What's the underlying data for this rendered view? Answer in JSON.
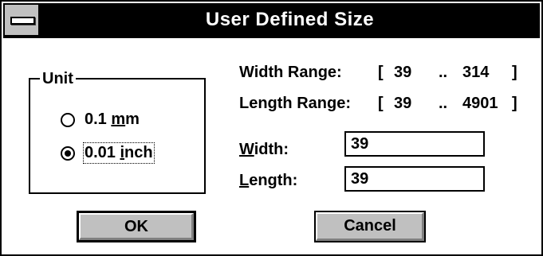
{
  "window": {
    "title": "User Defined Size"
  },
  "unit_group": {
    "label": "Unit",
    "options": [
      {
        "label_pre": "0.1 ",
        "label_u": "m",
        "label_post": "m",
        "selected": false
      },
      {
        "label_pre": "0.01 ",
        "label_u": "i",
        "label_post": "nch",
        "selected": true
      }
    ]
  },
  "ranges": {
    "width": {
      "label": "Width Range:",
      "open": "[",
      "min": "39",
      "sep": "..",
      "max": "314",
      "close": "]"
    },
    "length": {
      "label": "Length Range:",
      "open": "[",
      "min": "39",
      "sep": "..",
      "max": "4901",
      "close": "]"
    }
  },
  "fields": {
    "width": {
      "label_u": "W",
      "label_rest": "idth:",
      "value": "39"
    },
    "length": {
      "label_u": "L",
      "label_rest": "ength:",
      "value": "39"
    }
  },
  "buttons": {
    "ok": "OK",
    "cancel": "Cancel"
  },
  "colors": {
    "titlebar": "#000000",
    "title_text": "#ffffff",
    "button_face": "#c0c0c0",
    "background": "#ffffff"
  }
}
